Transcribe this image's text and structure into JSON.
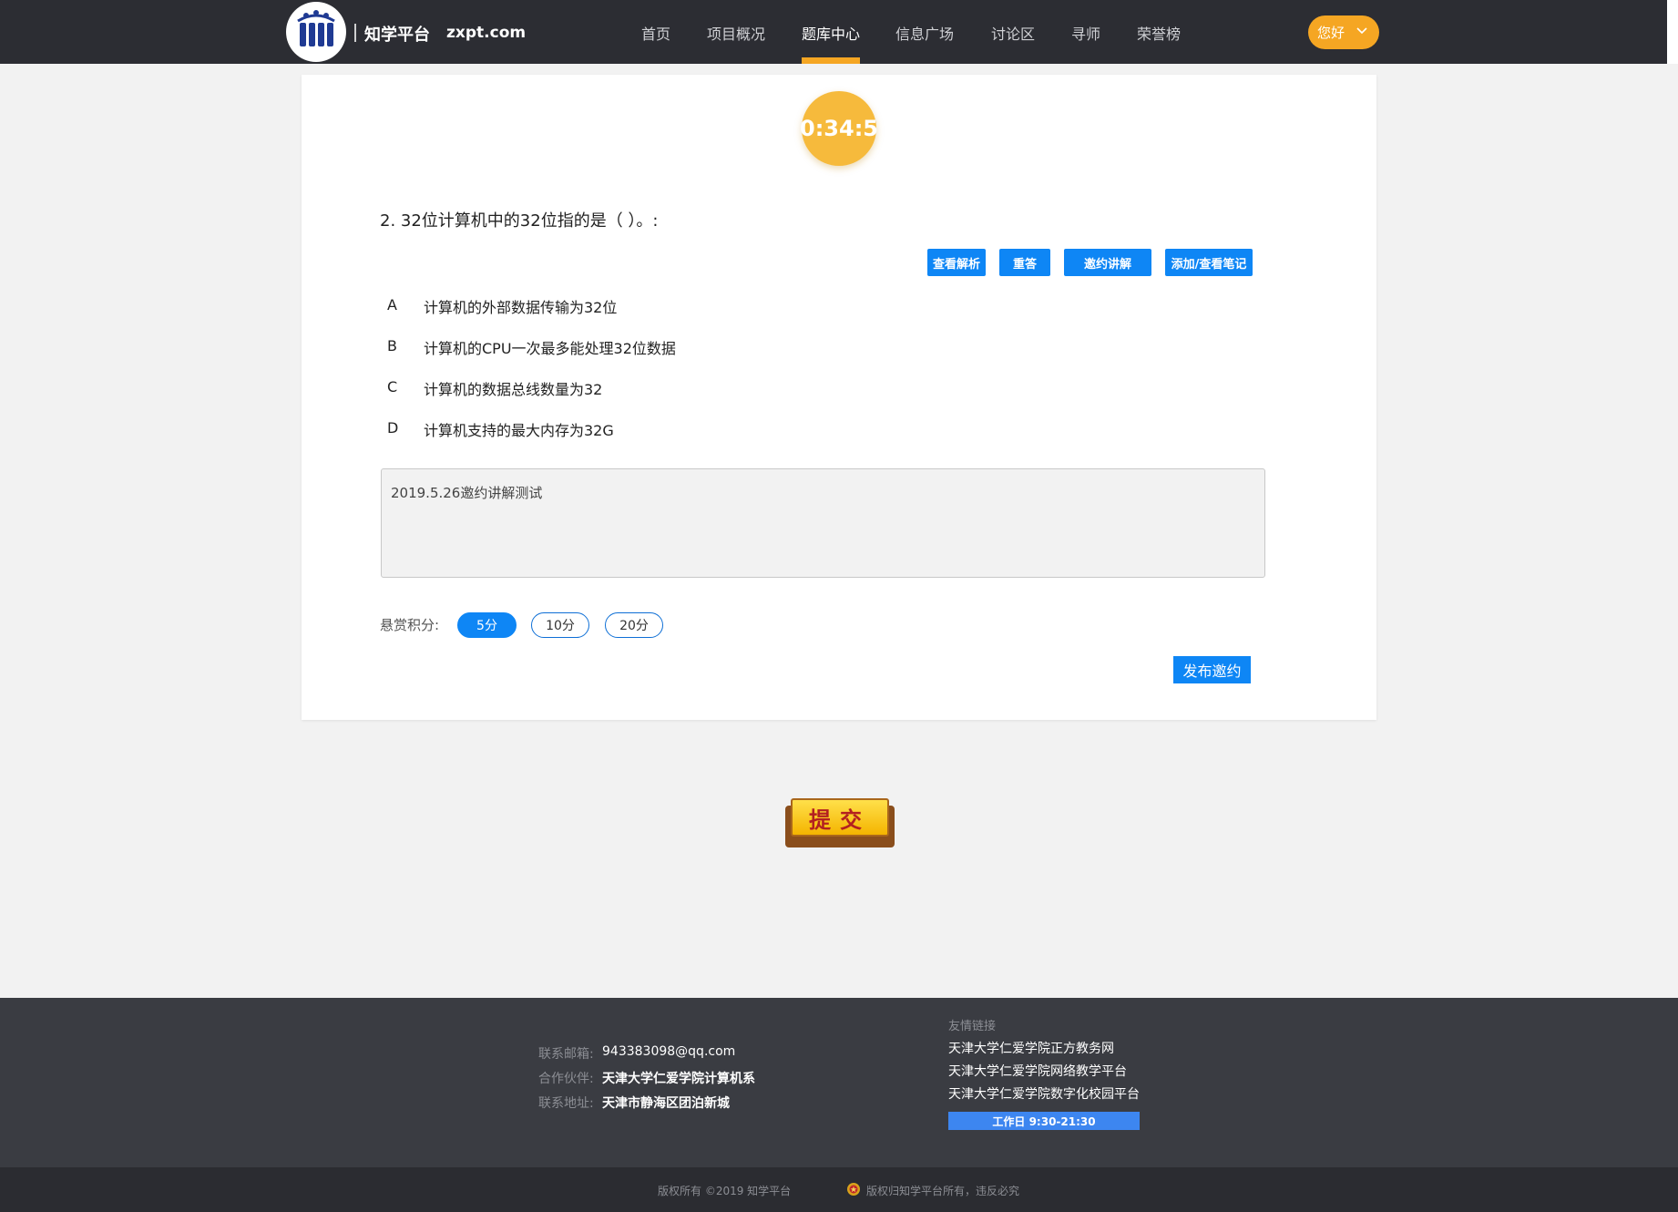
{
  "header": {
    "brand": "知学平台",
    "domain": "zxpt.com",
    "nav": [
      {
        "label": "首页"
      },
      {
        "label": "项目概况"
      },
      {
        "label": "题库中心",
        "active": true
      },
      {
        "label": "信息广场"
      },
      {
        "label": "讨论区"
      },
      {
        "label": "寻师"
      },
      {
        "label": "荣誉榜"
      }
    ],
    "user_label": "您好"
  },
  "timer": "0:34:5",
  "question": {
    "text": "2. 32位计算机中的32位指的是（ ）。:",
    "actions": [
      "查看解析",
      "重答",
      "邀约讲解",
      "添加/查看笔记"
    ],
    "options": [
      {
        "letter": "A",
        "text": "计算机的外部数据传输为32位"
      },
      {
        "letter": "B",
        "text": "计算机的CPU一次最多能处理32位数据"
      },
      {
        "letter": "C",
        "text": "计算机的数据总线数量为32"
      },
      {
        "letter": "D",
        "text": "计算机支持的最大内存为32G"
      }
    ]
  },
  "invite": {
    "note_value": "2019.5.26邀约讲解测试",
    "reward_label": "悬赏积分:",
    "rewards": [
      {
        "label": "5分",
        "selected": true
      },
      {
        "label": "10分",
        "selected": false
      },
      {
        "label": "20分",
        "selected": false
      }
    ],
    "publish_label": "发布邀约"
  },
  "submit_label": "提交",
  "footer": {
    "email_label": "联系邮箱:",
    "email": "943383098@qq.com",
    "partner_label": "合作伙伴:",
    "partner": "天津大学仁爱学院计算机系",
    "address_label": "联系地址:",
    "address": "天津市静海区团泊新城",
    "links_title": "友情链接",
    "links": [
      "天津大学仁爱学院正方教务网",
      "天津大学仁爱学院网络教学平台",
      "天津大学仁爱学院数字化校园平台"
    ],
    "work_hours": "工作日 9:30-21:30",
    "copyright": "版权所有 ©2019 知学平台",
    "rights": "版权归知学平台所有，违反必究"
  },
  "colors": {
    "accent_orange": "#f5a623",
    "primary_blue": "#0e86f5",
    "header_bg": "#2c2d33"
  }
}
